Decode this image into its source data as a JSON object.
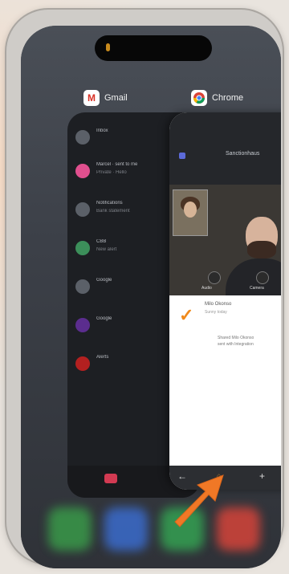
{
  "switcher": {
    "apps": [
      {
        "name": "Gmail",
        "icon": "gmail-icon"
      },
      {
        "name": "Chrome",
        "icon": "chrome-icon"
      }
    ]
  },
  "gmail_card": {
    "rows": [
      {
        "title": "Inbox",
        "sub": ""
      },
      {
        "title": "Marcel · sent to me",
        "sub": "Private · Hello"
      },
      {
        "title": "Notifications",
        "sub": "Bank statement"
      },
      {
        "title": "CBB",
        "sub": "New alert"
      },
      {
        "title": "Google",
        "sub": ""
      },
      {
        "title": "Google",
        "sub": ""
      },
      {
        "title": "Alerts",
        "sub": ""
      }
    ]
  },
  "chrome_card": {
    "url": "Sanctionhaus",
    "video_captions": [
      "Audio",
      "Camera"
    ],
    "chat_name": "Milo Okonso",
    "chat_line": "Sunny today",
    "chat_msg": "Shared Milo Okonso",
    "chat_msg2": "sent with Integration"
  },
  "colors": {
    "arrow": "#f07826",
    "accent_dot": "#c88a1c"
  }
}
